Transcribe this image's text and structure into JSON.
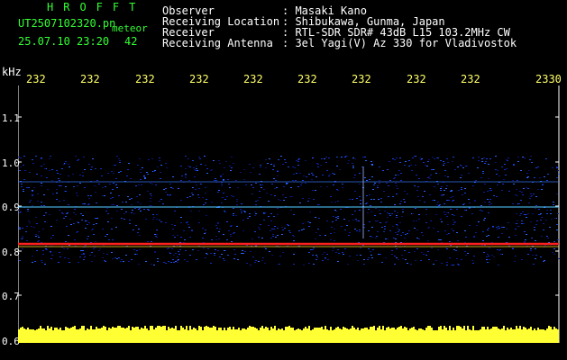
{
  "header": {
    "brand": "HROFFT",
    "filename": "UT2507102320.pn",
    "meteor_label": "meteor",
    "datetime": "25.07.10 23:20",
    "count": "42",
    "info": [
      {
        "label": "Observer",
        "value": ": Masaki Kano"
      },
      {
        "label": "Receiving Location",
        "value": ": Shibukawa, Gunma, Japan"
      },
      {
        "label": "Receiver",
        "value": ": RTL-SDR SDR# 43dB L15 103.2MHz CW"
      },
      {
        "label": "Receiving Antenna",
        "value": ": 3el Yagi(V) Az 330 for Vladivostok"
      }
    ]
  },
  "axis": {
    "unit": "kHz",
    "time_ticks": [
      "232",
      "232",
      "232",
      "232",
      "232",
      "232",
      "232",
      "232",
      "232",
      "2330"
    ],
    "freq_ticks": [
      "1.1",
      "1.0",
      "0.9",
      "0.8",
      "0.7",
      "0.6"
    ]
  },
  "colors": {
    "text": "#ffffff",
    "accent": "#33ff33",
    "tick": "#ffff66",
    "background": "#000000",
    "noise": "#0a1a8c",
    "signal": "#ff2020"
  }
}
